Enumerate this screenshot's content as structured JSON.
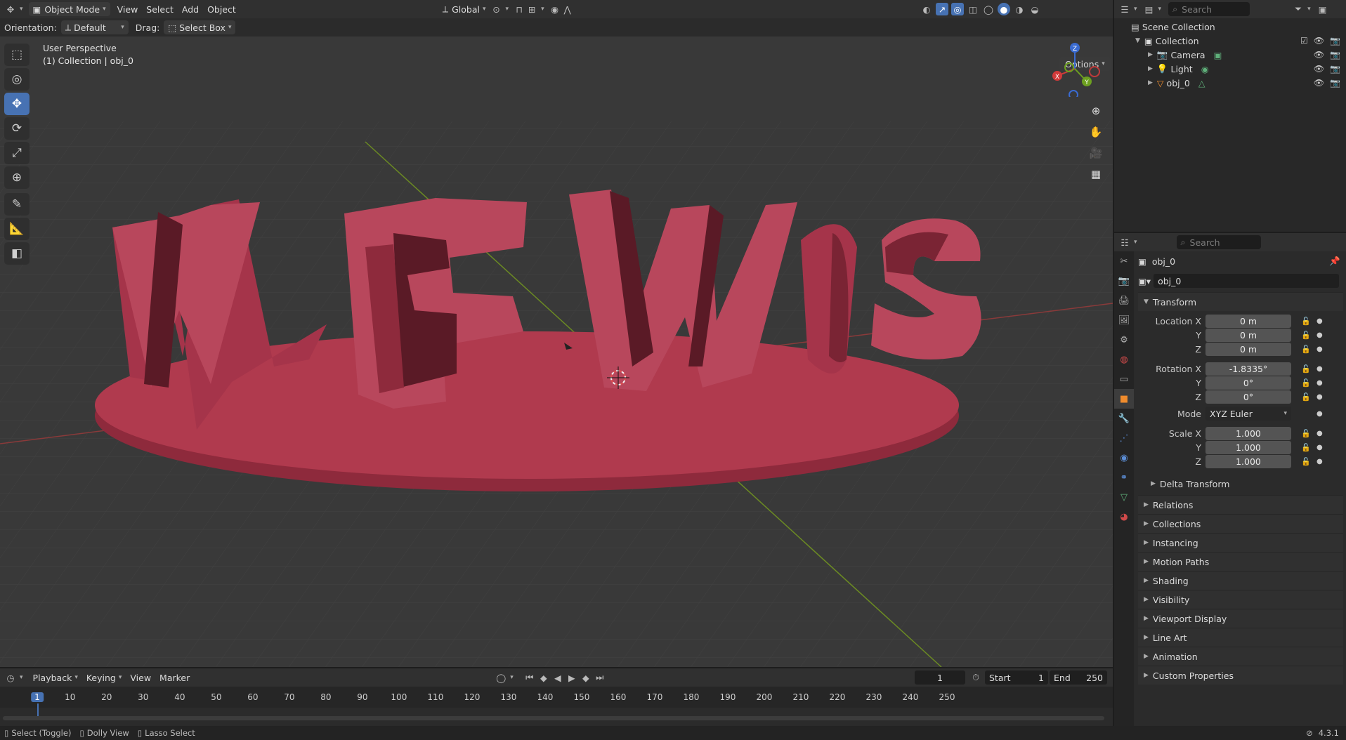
{
  "header": {
    "mode": "Object Mode",
    "menus": [
      "View",
      "Select",
      "Add",
      "Object"
    ],
    "transform_orientation": "Global"
  },
  "toolsettings": {
    "orientation_label": "Orientation:",
    "orientation_value": "Default",
    "drag_label": "Drag:",
    "drag_value": "Select Box",
    "options": "Options"
  },
  "viewport": {
    "perspective": "User Perspective",
    "collection_info": "(1) Collection | obj_0",
    "text_object": "WEWIS",
    "gizmo": {
      "x": "X",
      "y": "Y",
      "z": "Z"
    }
  },
  "outliner": {
    "search_placeholder": "Search",
    "scene_collection": "Scene Collection",
    "collection": "Collection",
    "objects": [
      "Camera",
      "Light",
      "obj_0"
    ]
  },
  "properties": {
    "search_placeholder": "Search",
    "object_name": "obj_0",
    "object_name_field": "obj_0",
    "transform_title": "Transform",
    "location": {
      "label": "Location X",
      "x": "0 m",
      "y": "0 m",
      "z": "0 m"
    },
    "rotation": {
      "label": "Rotation X",
      "x": "-1.8335°",
      "y": "0°",
      "z": "0°"
    },
    "mode": {
      "label": "Mode",
      "value": "XYZ Euler"
    },
    "scale": {
      "label": "Scale X",
      "x": "1.000",
      "y": "1.000",
      "z": "1.000"
    },
    "axis": {
      "y": "Y",
      "z": "Z"
    },
    "delta": "Delta Transform",
    "panels": [
      "Relations",
      "Collections",
      "Instancing",
      "Motion Paths",
      "Shading",
      "Visibility",
      "Viewport Display",
      "Line Art",
      "Animation",
      "Custom Properties"
    ]
  },
  "timeline": {
    "menus": [
      "Playback",
      "Keying",
      "View",
      "Marker"
    ],
    "current_frame": "1",
    "start_label": "Start",
    "start": "1",
    "end_label": "End",
    "end": "250",
    "ticks": [
      "1",
      "10",
      "20",
      "30",
      "40",
      "50",
      "60",
      "70",
      "80",
      "90",
      "100",
      "110",
      "120",
      "130",
      "140",
      "150",
      "160",
      "170",
      "180",
      "190",
      "200",
      "210",
      "220",
      "230",
      "240",
      "250"
    ]
  },
  "status": {
    "items": [
      "Select (Toggle)",
      "Dolly View",
      "Lasso Select"
    ],
    "version": "4.3.1"
  },
  "colors": {
    "accent": "#4772b3",
    "object": "#b43a4e"
  }
}
